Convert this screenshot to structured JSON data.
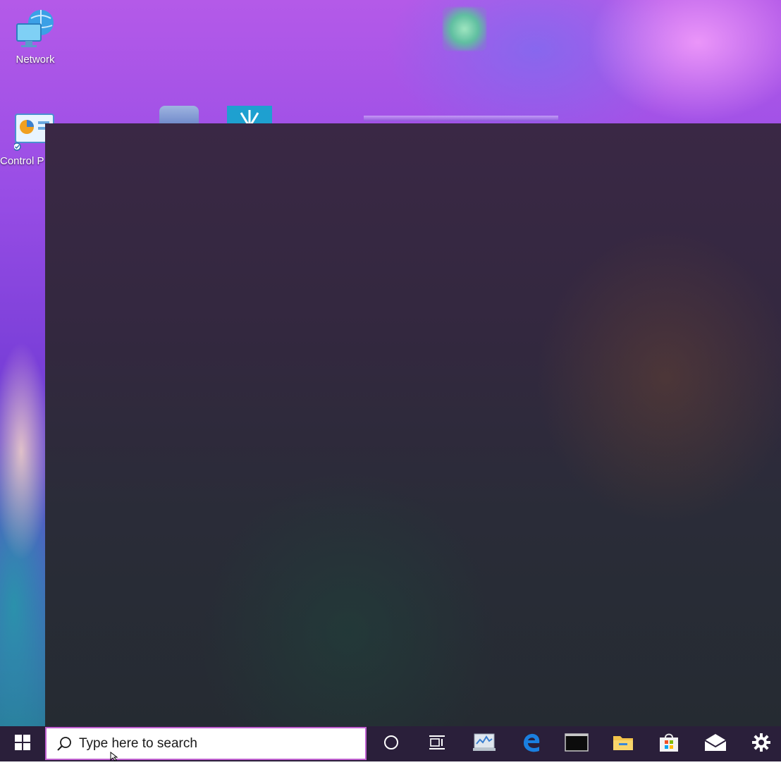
{
  "desktop": {
    "icons": [
      {
        "label": "Network",
        "icon": "network-icon"
      },
      {
        "label": "Control P",
        "icon": "control-panel-icon"
      }
    ]
  },
  "taskbar": {
    "search_placeholder": "Type here to search",
    "items": [
      {
        "name": "start-button",
        "icon": "windows-logo-icon"
      },
      {
        "name": "cortana-button",
        "icon": "circle-icon"
      },
      {
        "name": "task-view-button",
        "icon": "task-view-icon"
      },
      {
        "name": "performance-monitor-app",
        "icon": "monitor-chart-icon"
      },
      {
        "name": "edge-app",
        "icon": "edge-icon"
      },
      {
        "name": "command-prompt-app",
        "icon": "terminal-icon"
      },
      {
        "name": "file-explorer-app",
        "icon": "folder-icon"
      },
      {
        "name": "store-app",
        "icon": "store-bag-icon"
      },
      {
        "name": "mail-app",
        "icon": "mail-icon"
      },
      {
        "name": "settings-app",
        "icon": "gear-icon"
      }
    ]
  },
  "colors": {
    "taskbar": "#2a1f3a",
    "search_border": "#c060d0",
    "panel": "#2f2a3c",
    "accent_blue": "#0078d7"
  }
}
